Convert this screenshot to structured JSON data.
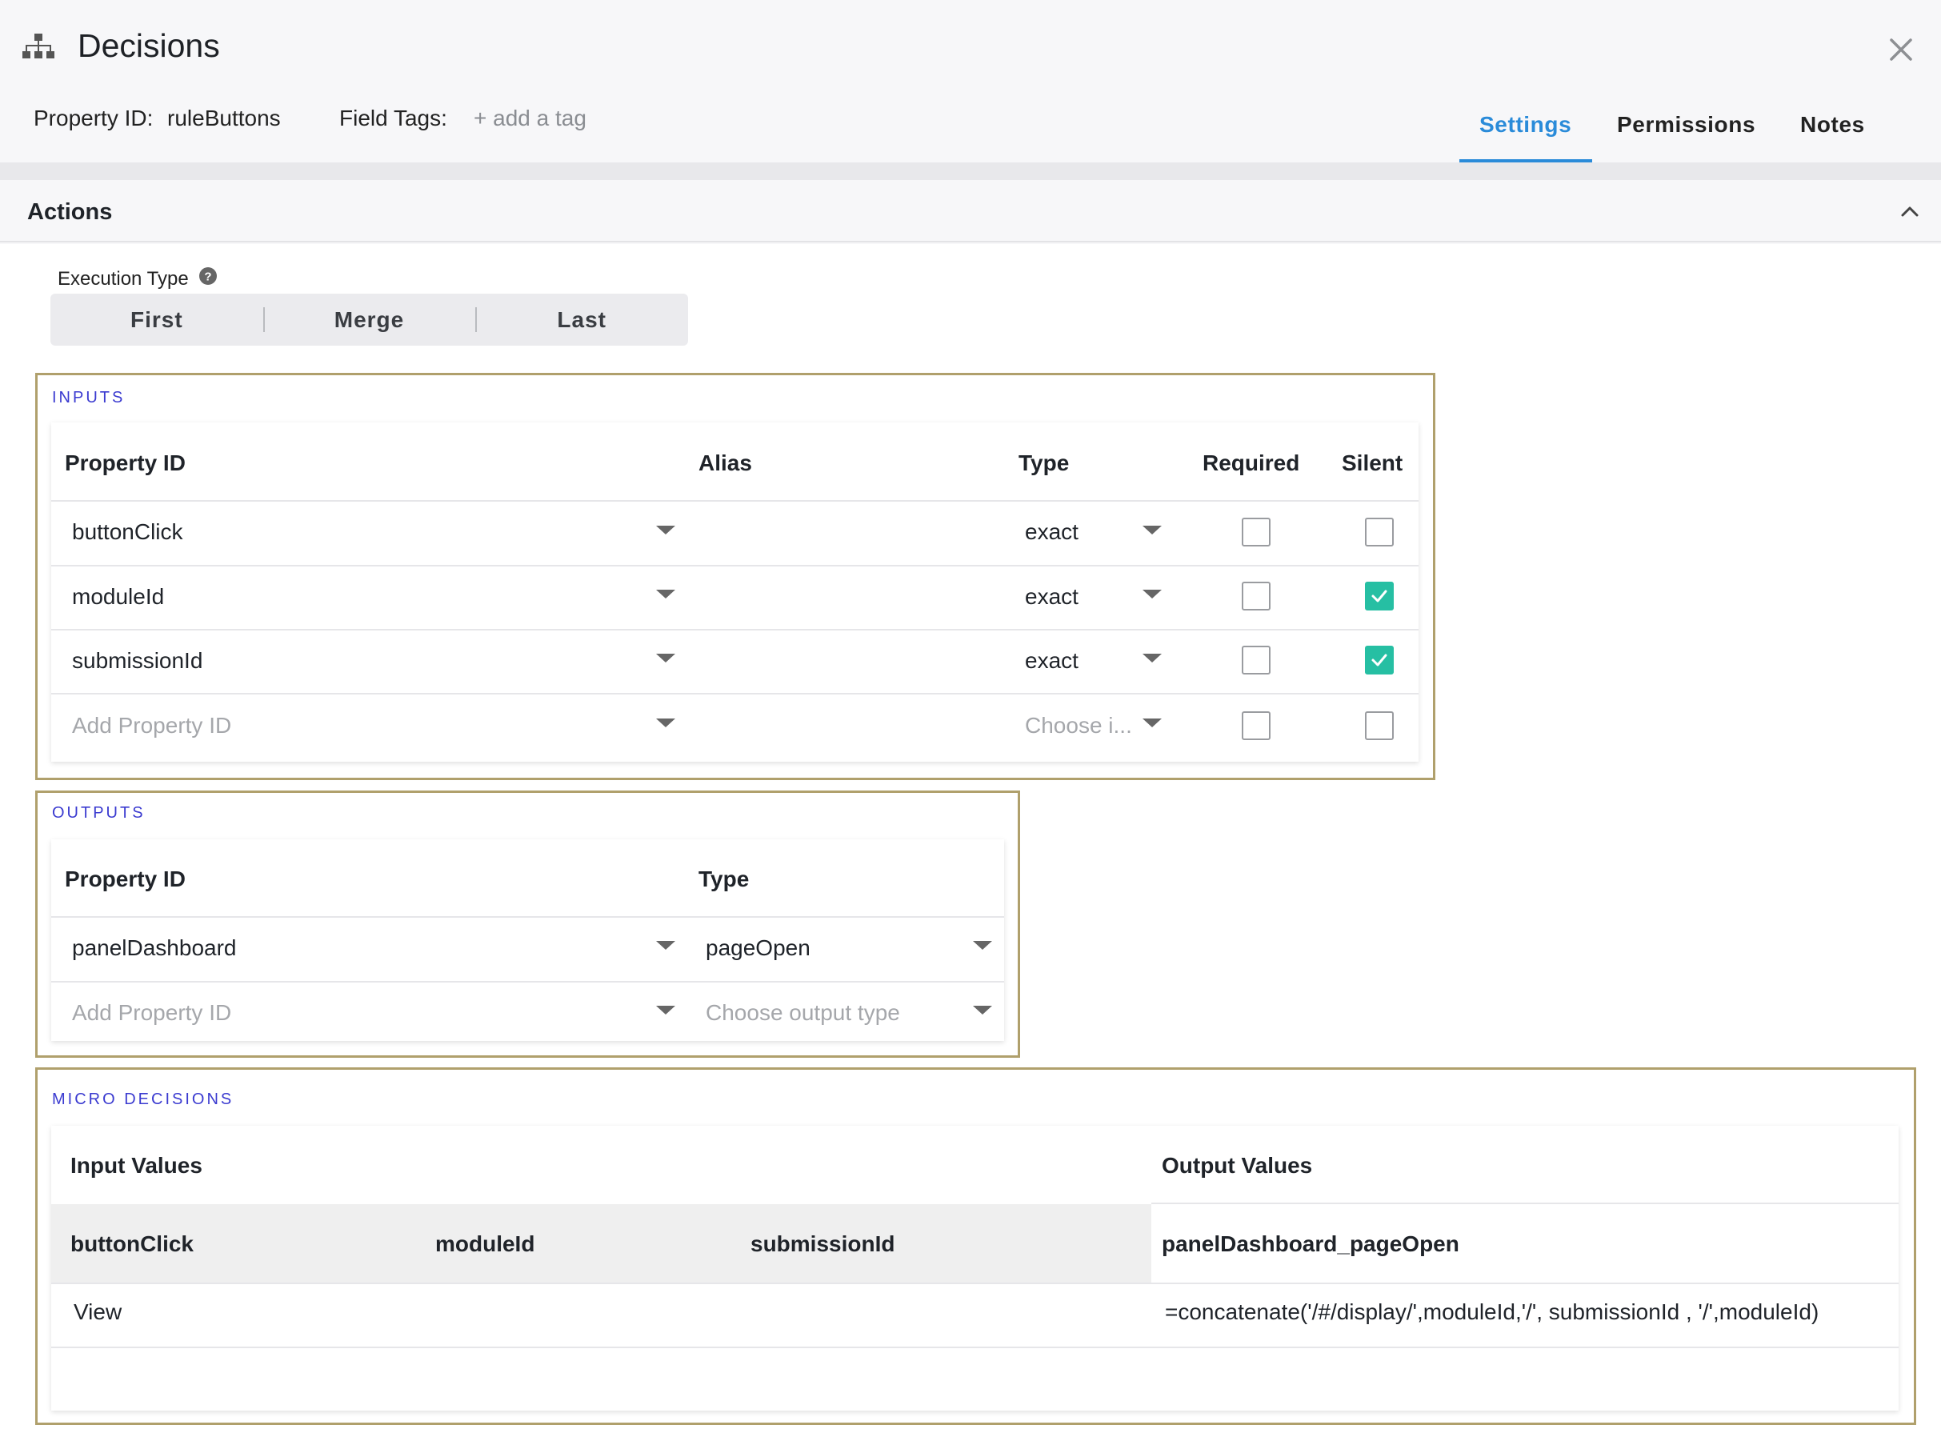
{
  "header": {
    "title": "Decisions",
    "property_id_label": "Property ID:",
    "property_id_value": "ruleButtons",
    "field_tags_label": "Field Tags:",
    "add_tag": "+ add a tag",
    "tabs": [
      {
        "label": "Settings",
        "active": true
      },
      {
        "label": "Permissions",
        "active": false
      },
      {
        "label": "Notes",
        "active": false
      }
    ]
  },
  "actions": {
    "title": "Actions",
    "execution_type_label": "Execution Type",
    "execution_types": [
      "First",
      "Merge",
      "Last"
    ]
  },
  "inputs": {
    "title": "INPUTS",
    "columns": {
      "property_id": "Property ID",
      "alias": "Alias",
      "type": "Type",
      "required": "Required",
      "silent": "Silent"
    },
    "rows": [
      {
        "property_id": "buttonClick",
        "alias": "",
        "type": "exact",
        "required": false,
        "silent": false
      },
      {
        "property_id": "moduleId",
        "alias": "",
        "type": "exact",
        "required": false,
        "silent": true
      },
      {
        "property_id": "submissionId",
        "alias": "",
        "type": "exact",
        "required": false,
        "silent": true
      }
    ],
    "add_row": {
      "property_placeholder": "Add Property ID",
      "type_placeholder": "Choose i..."
    }
  },
  "outputs": {
    "title": "OUTPUTS",
    "columns": {
      "property_id": "Property ID",
      "type": "Type"
    },
    "rows": [
      {
        "property_id": "panelDashboard",
        "type": "pageOpen"
      }
    ],
    "add_row": {
      "property_placeholder": "Add Property ID",
      "type_placeholder": "Choose output type"
    }
  },
  "micro_decisions": {
    "title": "MICRO DECISIONS",
    "input_values_label": "Input Values",
    "output_values_label": "Output Values",
    "input_columns": [
      "buttonClick",
      "moduleId",
      "submissionId"
    ],
    "output_columns": [
      "panelDashboard_pageOpen"
    ],
    "rows": [
      {
        "inputs": [
          "View",
          "",
          ""
        ],
        "outputs": [
          "=concatenate('/#/display/',moduleId,'/', submissionId , '/',moduleId)"
        ]
      }
    ]
  },
  "colors": {
    "accent": "#2a8bd9",
    "checkbox_checked": "#26bfa3",
    "section_border": "#b0a06c",
    "section_title": "#3b3bd0"
  }
}
